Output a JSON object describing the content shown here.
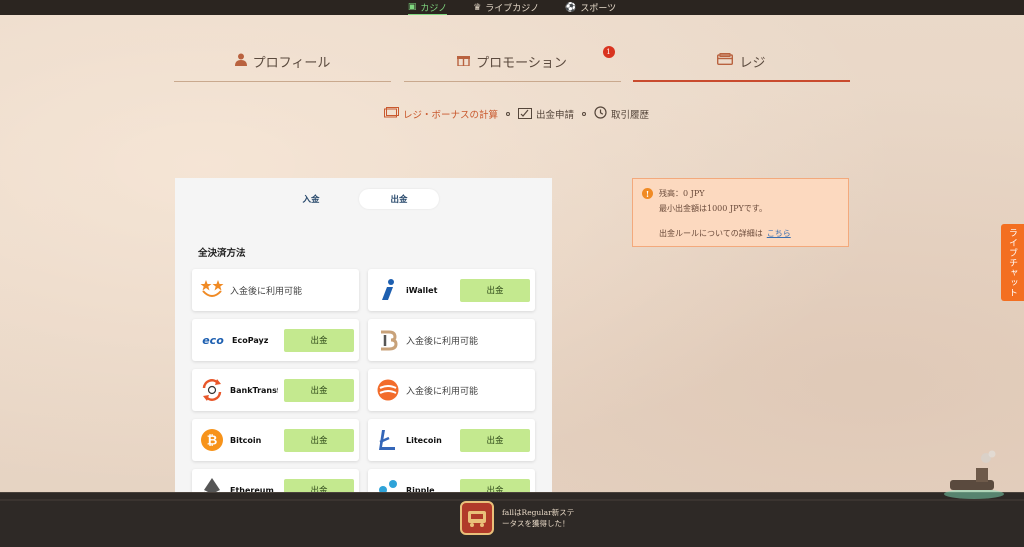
{
  "topnav": {
    "items": [
      {
        "label": "カジノ",
        "icon": "slot-icon",
        "active": true
      },
      {
        "label": "ライブカジノ",
        "icon": "dealer-icon",
        "active": false
      },
      {
        "label": "スポーツ",
        "icon": "ball-icon",
        "active": false
      }
    ]
  },
  "tabs": {
    "profile": "プロフィール",
    "promotion": "プロモーション",
    "promotion_badge": "1",
    "cashier": "レジ"
  },
  "subnav": {
    "bonus_calc": "レジ・ボーナスの計算",
    "withdraw_request": "出金申請",
    "history": "取引履歴"
  },
  "panel": {
    "deposit_tab": "入金",
    "withdraw_tab": "出金",
    "section_title": "全決済方法",
    "methods": [
      {
        "name": "入金後に利用可能",
        "icon": "stars-icon",
        "button": ""
      },
      {
        "name": "iWallet",
        "icon": "iwallet-icon",
        "button": "出金"
      },
      {
        "name": "EcoPayz",
        "icon": "ecopayz-icon",
        "button": "出金"
      },
      {
        "name": "入金後に利用可能",
        "icon": "b-logo-icon",
        "button": ""
      },
      {
        "name": "BankTransfer",
        "icon": "bank-transfer-icon",
        "button": "出金"
      },
      {
        "name": "入金後に利用可能",
        "icon": "orange-circle-icon",
        "button": ""
      },
      {
        "name": "Bitcoin",
        "icon": "bitcoin-icon",
        "button": "出金"
      },
      {
        "name": "Litecoin",
        "icon": "litecoin-icon",
        "button": "出金"
      },
      {
        "name": "Ethereum",
        "icon": "ethereum-icon",
        "button": "出金"
      },
      {
        "name": "Ripple",
        "icon": "ripple-icon",
        "button": "出金"
      }
    ]
  },
  "info": {
    "balance": "残高：0 JPY",
    "minimum": "最小出金額は1000 JPYです。",
    "rules_text": "出金ルールについての詳細は",
    "rules_link": "こちら"
  },
  "livechat": "ライブチャット",
  "toast": {
    "message": "fallはRegular新ステータスを獲得した！"
  },
  "colors": {
    "accent": "#c94b2e",
    "button_green": "#c4e98f",
    "info_bg": "#fcd9bf",
    "livechat": "#f36f21"
  }
}
